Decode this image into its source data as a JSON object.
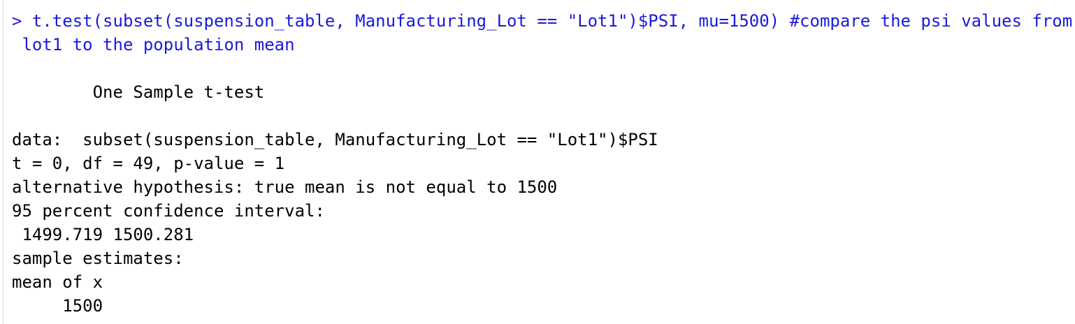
{
  "console": {
    "command_line_1": "> t.test(subset(suspension_table, Manufacturing_Lot == \"Lot1\")$PSI, mu=1500) #compare the psi values from",
    "command_line_2": " lot1 to the population mean",
    "test_title": "        One Sample t-test",
    "data_line": "data:  subset(suspension_table, Manufacturing_Lot == \"Lot1\")$PSI",
    "stats_line": "t = 0, df = 49, p-value = 1",
    "alt_hypothesis": "alternative hypothesis: true mean is not equal to 1500",
    "ci_label": "95 percent confidence interval:",
    "ci_values": " 1499.719 1500.281",
    "estimates_label": "sample estimates:",
    "estimate_name": "mean of x",
    "estimate_value": "     1500"
  },
  "colors": {
    "command": "#1a1adb",
    "output": "#000000",
    "background": "#ffffff"
  }
}
